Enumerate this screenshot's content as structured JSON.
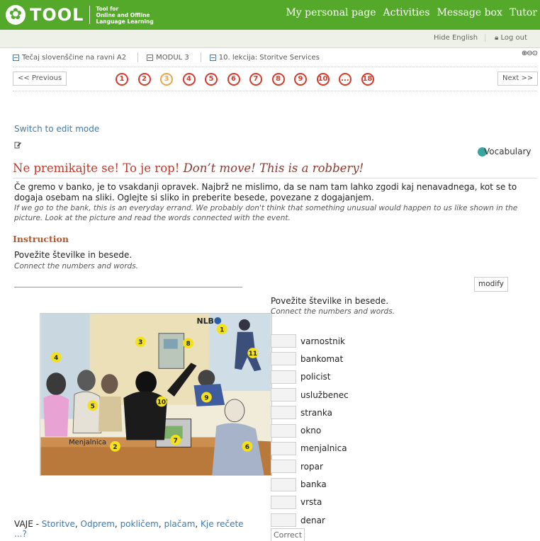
{
  "brand": {
    "name": "TOOL",
    "tagline_1": "Tool for",
    "tagline_2": "Online and Offline",
    "tagline_3": "Language Learning"
  },
  "topnav": [
    "My personal page",
    "Activities",
    "Message box",
    "Tutor"
  ],
  "subbar": {
    "hide_english": "Hide English",
    "logout": "Log out"
  },
  "breadcrumb": [
    "Tečaj slovenščine na ravni A2",
    "MODUL 3",
    "10. lekcija: Storitve Services"
  ],
  "pager": {
    "prev": "<< Previous",
    "next": "Next >>",
    "pages": [
      "1",
      "2",
      "3",
      "4",
      "5",
      "6",
      "7",
      "8",
      "9",
      "10",
      "...",
      "18"
    ],
    "current_index": 2
  },
  "edit_link": "Switch to edit mode",
  "vocabulary": "Vocabulary",
  "title": {
    "sl": "Ne premikajte se! To je rop!",
    "en": "Don’t move! This is a robbery!"
  },
  "intro": {
    "sl": "Če gremo v banko, je to vsakdanji opravek. Najbrž ne mislimo, da se nam tam lahko zgodi kaj nenavadnega, kot se to dogaja osebam na sliki. Oglejte si sliko in preberite besede, povezane z dogajanjem.",
    "en": "If we go to the bank, this is an everyday errand. We probably don't think that something unusual would happen to us like shown in the picture. Look at the picture and read the words connected with the event."
  },
  "instruction": {
    "heading": "Instruction",
    "sl": "Povežite številke in besede.",
    "en": "Connect the numbers and words."
  },
  "modify": "modify",
  "exercise": {
    "sl": "Povežite številke in besede.",
    "en": "Connect the numbers and words.",
    "words": [
      "varnostnik",
      "bankomat",
      "policist",
      "uslužbenec",
      "stranka",
      "okno",
      "menjalnica",
      "ropar",
      "banka",
      "vrsta",
      "denar"
    ],
    "correct": "Correct"
  },
  "picture": {
    "bank_sign": "NLB",
    "exchange_sign": "Menjalnica",
    "numbers": [
      "1",
      "2",
      "3",
      "4",
      "5",
      "6",
      "7",
      "8",
      "9",
      "10",
      "11"
    ]
  },
  "vaje": {
    "prefix": "VAJE - ",
    "links": [
      "Storitve",
      "Odprem",
      "pokličem",
      "plačam",
      "Kje rečete ...?"
    ]
  },
  "colors": {
    "header_green": "#54a92a",
    "page_number_red": "#d93a2b",
    "title_red": "#c0392b"
  }
}
